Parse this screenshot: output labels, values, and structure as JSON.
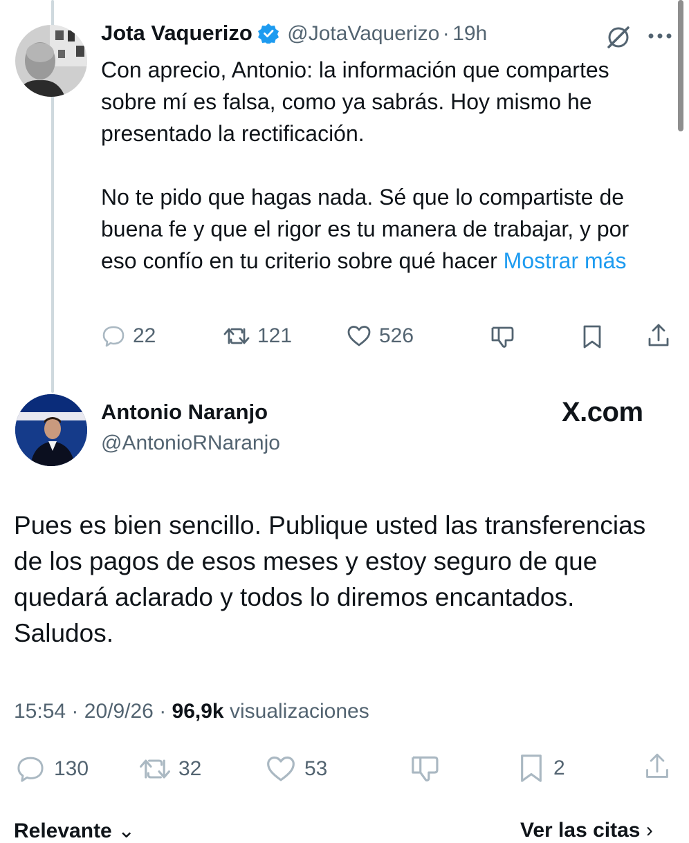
{
  "reply": {
    "author_name": "Jota Vaquerizo",
    "author_handle": "@JotaVaquerizo",
    "time": "19h",
    "separator": "·",
    "text_p1": "Con aprecio, Antonio: la información que compartes sobre mí es falsa, como ya sabrás. Hoy mismo he presentado la rectificación.",
    "text_p2": "No te pido que hagas nada. Sé que lo compartiste de buena fe y que el rigor es tu manera de trabajar, y por eso confío en tu criterio sobre qué hacer",
    "show_more": "Mostrar más",
    "stats": {
      "replies": "22",
      "retweets": "121",
      "likes": "526"
    }
  },
  "main_tweet": {
    "author_name": "Antonio Naranjo",
    "author_handle": "@AntonioRNaranjo",
    "watermark": "X.com",
    "text": "Pues es bien sencillo. Publique usted las transferencias de los pagos de esos meses y estoy seguro de que quedará aclarado y todos lo diremos encantados. Saludos.",
    "time": "15:54",
    "date": "20/9/26",
    "views_count": "96,9k",
    "views_label": "visualizaciones",
    "separator": "·",
    "stats": {
      "replies": "130",
      "retweets": "32",
      "likes": "53",
      "bookmarks": "2"
    }
  },
  "footer": {
    "left": "Relevante",
    "right": "Ver las citas"
  },
  "icons": [
    "verified-badge-icon",
    "grok-icon",
    "more-icon",
    "reply-icon",
    "retweet-icon",
    "like-icon",
    "dislike-icon",
    "bookmark-icon",
    "share-icon"
  ],
  "colors": {
    "accent": "#1d9bf0",
    "secondary_text": "#536471",
    "faded": "#aab8c2"
  }
}
